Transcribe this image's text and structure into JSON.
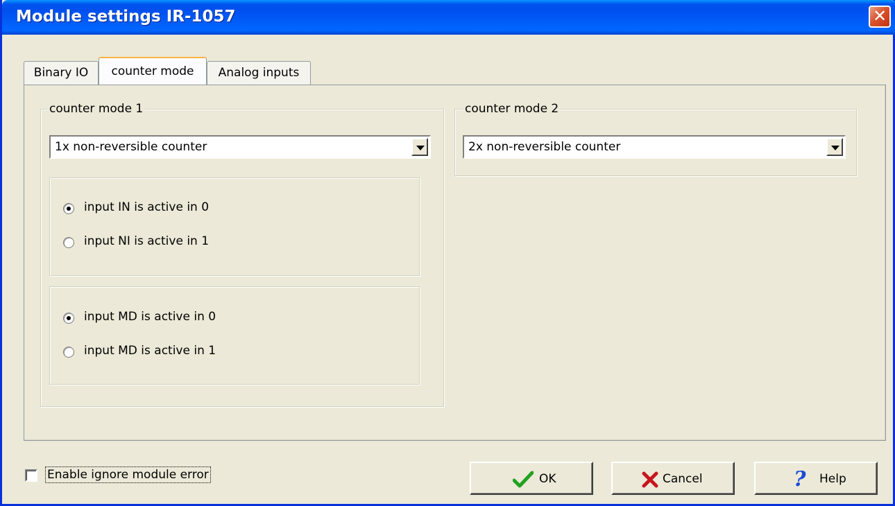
{
  "window": {
    "title": "Module settings IR-1057",
    "close_symbol": "✕"
  },
  "tabs": [
    {
      "label": "Binary IO",
      "active": false
    },
    {
      "label": "counter mode",
      "active": true
    },
    {
      "label": "Analog inputs",
      "active": false
    }
  ],
  "counter_mode_1": {
    "title": "counter mode 1",
    "select_value": "1x non-reversible counter",
    "group_a": {
      "options": [
        {
          "label": "input IN is active in 0",
          "checked": true
        },
        {
          "label": "input NI is active in 1",
          "checked": false
        }
      ]
    },
    "group_b": {
      "options": [
        {
          "label": "input MD is active in 0",
          "checked": true
        },
        {
          "label": "input MD is active in 1",
          "checked": false
        }
      ]
    }
  },
  "counter_mode_2": {
    "title": "counter mode 2",
    "select_value": "2x non-reversible counter"
  },
  "footer": {
    "checkbox_label": "Enable ignore module error",
    "checkbox_checked": false,
    "ok_label": "OK",
    "cancel_label": "Cancel",
    "help_label": "Help"
  },
  "colors": {
    "titlebar": "#0054e3",
    "ok_icon": "#21a121",
    "cancel_icon": "#c8141e",
    "help_icon": "#1c4bd4",
    "face": "#ece9d8"
  },
  "icons": {
    "close": "close-icon",
    "ok": "checkmark-icon",
    "cancel": "x-icon",
    "help": "question-icon",
    "dropdown": "chevron-down-icon"
  }
}
